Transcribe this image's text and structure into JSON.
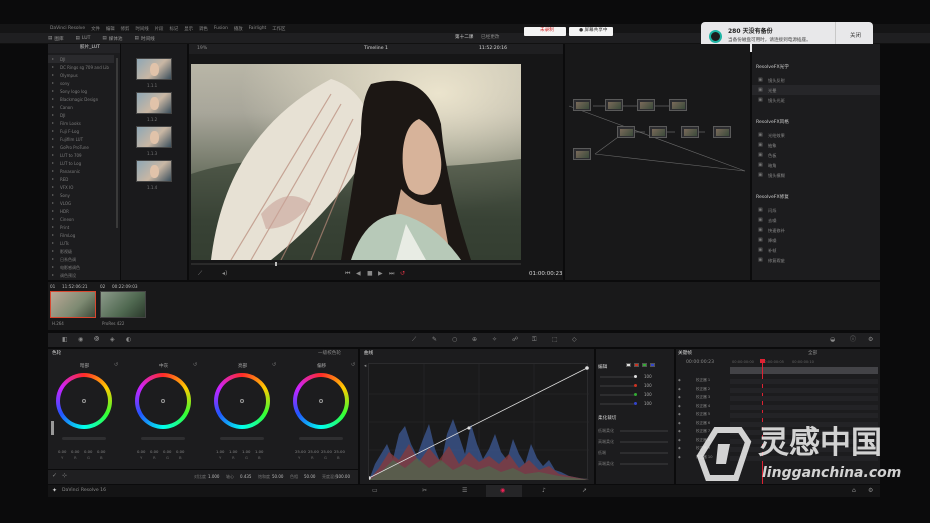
{
  "menubar": {
    "items": [
      "DaVinci Resolve",
      "文件",
      "编辑",
      "修剪",
      "时间线",
      "片段",
      "标记",
      "显示",
      "调色",
      "Fusion",
      "播放",
      "Fairlight",
      "工作区"
    ]
  },
  "header": {
    "tabs": [
      "图库",
      "LUT",
      "媒体池",
      "时间线"
    ],
    "zoom": "19%",
    "timeline_name": "Timeline 1",
    "project_title": "第十二课",
    "status_suffix": "已经更改",
    "timecode_top": "11:52:20:16",
    "rec_badge": "未录制",
    "live_badge": "● 屏幕共享中",
    "mode_label": "片段"
  },
  "notification": {
    "title": "280 天没有备份",
    "body": "当备份磁盘可用时，请连接到电源插座。",
    "close_label": "关闭",
    "accent": "#1fb5a5"
  },
  "lut_panel": {
    "title": "胶片_LUT",
    "items": [
      "DJI",
      "DC Rings sg 709 and Lib",
      "Olympus",
      "sony",
      "Sony logo log",
      "Blackmagic Design",
      "Canon",
      "DJI",
      "Film Looks",
      "Fuji F-Log",
      "Fujifilm LUT",
      "GoPro ProTune",
      "LUT to 709",
      "LUT to Log",
      "Panasonic",
      "RED",
      "VFX IO",
      "Sony",
      "VLOG",
      "HDR",
      "Cineon",
      "Print",
      "FilmLog",
      "LUTs",
      "影视级",
      "日系色调",
      "电影感调色",
      "调色预设"
    ]
  },
  "gallery": {
    "stills": [
      "1.1.1",
      "1.1.2",
      "1.1.3",
      "1.1.4"
    ]
  },
  "viewer": {
    "timecode": "01:00:00:23"
  },
  "clips": [
    {
      "num": "01",
      "tc": "11:52:06:21",
      "caption": "H.264"
    },
    {
      "num": "02",
      "tc": "00:22:09:03",
      "caption": "ProRes 422"
    }
  ],
  "resolvefx": {
    "sections": [
      {
        "title": "ResolveFX光学",
        "items": [
          "镜头反射",
          "光晕",
          "镜头光斑"
        ]
      },
      {
        "title": "ResolveFX风格",
        "items": [
          "光绘效果",
          "抽象",
          "色板",
          "暗角",
          "镜头模糊"
        ]
      },
      {
        "title": "ResolveFX修复",
        "items": [
          "闪烁",
          "去噪",
          "快速修补",
          "降噪",
          "补帧",
          "修复瑕疵"
        ]
      }
    ]
  },
  "color_panel": {
    "title": "色轮",
    "mode": "一级校色轮",
    "wheels": [
      {
        "label": "暗部",
        "values": [
          "0.00",
          "0.00",
          "0.00",
          "0.00"
        ]
      },
      {
        "label": "中灰",
        "values": [
          "0.00",
          "0.00",
          "0.00",
          "0.00"
        ]
      },
      {
        "label": "亮部",
        "values": [
          "1.00",
          "1.00",
          "1.00",
          "1.00"
        ]
      },
      {
        "label": "偏移",
        "values": [
          "25.00",
          "25.00",
          "25.00",
          "25.00"
        ]
      }
    ],
    "rgby": [
      "Y",
      "R",
      "G",
      "B"
    ],
    "footer": [
      {
        "label": "对比度",
        "value": "1.000"
      },
      {
        "label": "轴心",
        "value": "0.435"
      },
      {
        "label": "饱和度",
        "value": "50.00"
      },
      {
        "label": "色相",
        "value": "50.00"
      },
      {
        "label": "亮度混合",
        "value": "100.00"
      }
    ]
  },
  "curves": {
    "title": "曲线",
    "edit_label": "编辑",
    "channels": [
      "100",
      "100",
      "100",
      "100"
    ],
    "soft_label": "柔化裁切",
    "soft_rows": [
      "低端柔化",
      "高端柔化",
      "低端",
      "高端柔化"
    ]
  },
  "keyframes": {
    "title": "关键帧",
    "filter": "全部",
    "timecode": "00:00:00:23",
    "ruler": [
      "00:00:00:00",
      "00:00:00:05",
      "00:00:00:10"
    ],
    "tracks": [
      "校正器 1",
      "校正器 2",
      "校正器 3",
      "校正器 4",
      "校正器 5",
      "校正器 6",
      "校正器 7",
      "校正器 8",
      "校正器 9",
      "校正器 10"
    ]
  },
  "app_footer": {
    "name": "DaVinci Resolve 16"
  },
  "watermark": {
    "brand_cn": "灵感中国",
    "brand_url": "lingganchina.com"
  }
}
